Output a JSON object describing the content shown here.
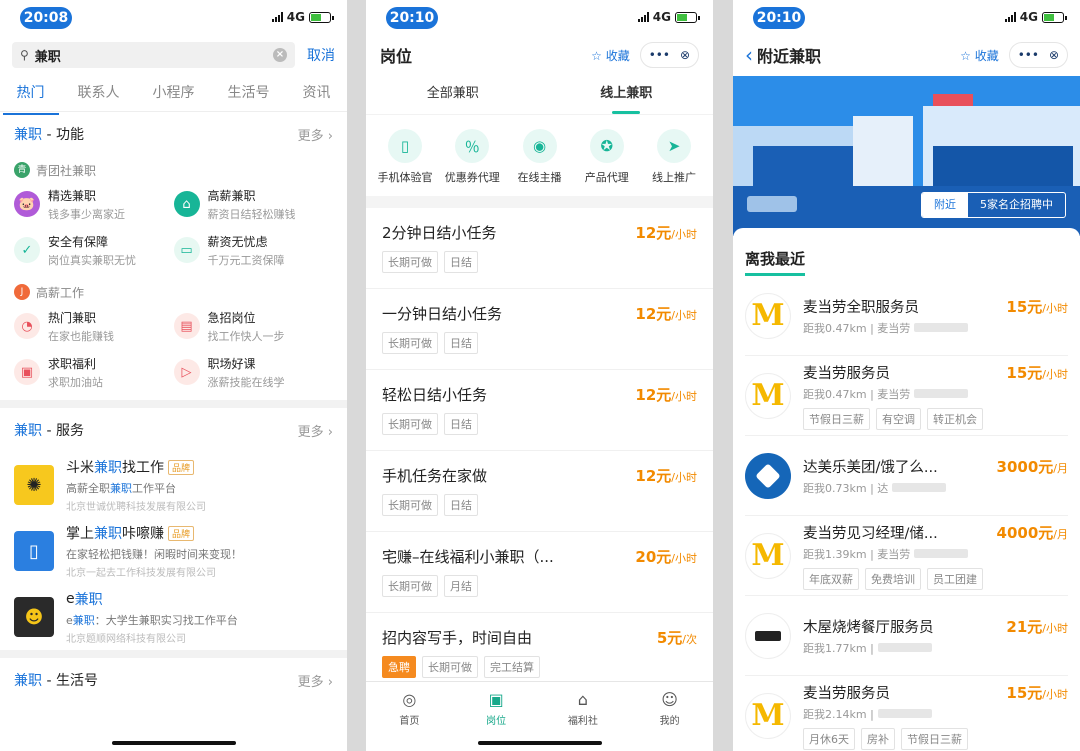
{
  "status": {
    "p1_time": "20:08",
    "p2_time": "20:10",
    "p3_time": "20:10",
    "network": "4G"
  },
  "p1": {
    "search_value": "兼职",
    "cancel": "取消",
    "tabs": [
      "热门",
      "联系人",
      "小程序",
      "生活号",
      "资讯"
    ],
    "func": {
      "kw": "兼职",
      "suffix": " - 功能",
      "more": "更多",
      "groups": [
        {
          "name": "青团社兼职",
          "badge": "青",
          "color": "#3aa36a",
          "items": [
            {
              "title": "精选兼职",
              "desc": "钱多事少离家近",
              "icon": "piggy-icon",
              "glyph": "🐷",
              "bg": "#b05bd8"
            },
            {
              "title": "高薪兼职",
              "desc": "薪资日结轻松赚钱",
              "icon": "house-icon",
              "glyph": "⌂",
              "bg": "#17b597"
            },
            {
              "title": "安全有保障",
              "desc": "岗位真实兼职无忧",
              "icon": "shield-icon",
              "glyph": "✓",
              "bg": "#e7f8f2"
            },
            {
              "title": "薪资无忧虑",
              "desc": "千万元工资保障",
              "icon": "wallet-icon",
              "glyph": "▭",
              "bg": "#e7f8f2"
            }
          ]
        },
        {
          "name": "高薪工作",
          "badge": "J",
          "color": "#f06a3a",
          "items": [
            {
              "title": "热门兼职",
              "desc": "在家也能赚钱",
              "icon": "clock-icon",
              "glyph": "◔",
              "bg": "#fde9e6"
            },
            {
              "title": "急招岗位",
              "desc": "找工作快人一步",
              "icon": "id-card-icon",
              "glyph": "▤",
              "bg": "#fde9e6"
            },
            {
              "title": "求职福利",
              "desc": "求职加油站",
              "icon": "gift-icon",
              "glyph": "▣",
              "bg": "#fde9e6"
            },
            {
              "title": "职场好课",
              "desc": "涨薪技能在线学",
              "icon": "play-icon",
              "glyph": "▷",
              "bg": "#fde9e6"
            }
          ]
        }
      ]
    },
    "service": {
      "kw": "兼职",
      "suffix": " - 服务",
      "more": "更多",
      "items": [
        {
          "pre": "斗米",
          "kw": "兼职",
          "post": "找工作",
          "badge": "品牌",
          "d_pre": "高薪全职",
          "d_kw": "兼职",
          "d_post": "工作平台",
          "company": "北京世诚优聘科技发展有限公司",
          "logo_bg": "#f7c81e",
          "glyph": "✺",
          "icon": "doumi-logo-icon"
        },
        {
          "pre": "掌上",
          "kw": "兼职",
          "post": "咔嚓赚",
          "badge": "品牌",
          "d_pre": "在家轻松把钱赚！闲暇时间来变现！",
          "d_kw": "",
          "d_post": "",
          "company": "北京一起去工作科技发展有限公司",
          "logo_bg": "#2b7fe0",
          "glyph": "▯",
          "icon": "phone-logo-icon"
        },
        {
          "pre": "e",
          "kw": "兼职",
          "post": "",
          "badge": "",
          "d_pre": "e",
          "d_kw": "兼职",
          "d_post": "：大学生兼职实习找工作平台",
          "company": "北京题顺网络科技有限公司",
          "logo_bg": "#2a2a2a",
          "glyph": "☻",
          "icon": "e-jianzhi-logo-icon"
        }
      ]
    },
    "life": {
      "kw": "兼职",
      "suffix": " - 生活号",
      "more": "更多"
    }
  },
  "p2": {
    "title": "岗位",
    "fav": "收藏",
    "more_dots": "•••",
    "tabs": [
      "全部兼职",
      "线上兼职"
    ],
    "cats": [
      {
        "label": "手机体验官",
        "icon": "phone-icon",
        "glyph": "▯"
      },
      {
        "label": "优惠券代理",
        "icon": "coupon-icon",
        "glyph": "％"
      },
      {
        "label": "在线主播",
        "icon": "streamer-icon",
        "glyph": "◉"
      },
      {
        "label": "产品代理",
        "icon": "medal-icon",
        "glyph": "✪"
      },
      {
        "label": "线上推广",
        "icon": "paper-plane-icon",
        "glyph": "➤"
      }
    ],
    "jobs": [
      {
        "title": "2分钟日结小任务",
        "price": "12元",
        "unit": "/小时",
        "tags": [
          {
            "t": "长期可做",
            "hot": false
          },
          {
            "t": "日结",
            "hot": false
          }
        ]
      },
      {
        "title": "一分钟日结小任务",
        "price": "12元",
        "unit": "/小时",
        "tags": [
          {
            "t": "长期可做",
            "hot": false
          },
          {
            "t": "日结",
            "hot": false
          }
        ]
      },
      {
        "title": "轻松日结小任务",
        "price": "12元",
        "unit": "/小时",
        "tags": [
          {
            "t": "长期可做",
            "hot": false
          },
          {
            "t": "日结",
            "hot": false
          }
        ]
      },
      {
        "title": "手机任务在家做",
        "price": "12元",
        "unit": "/小时",
        "tags": [
          {
            "t": "长期可做",
            "hot": false
          },
          {
            "t": "日结",
            "hot": false
          }
        ]
      },
      {
        "title": "宅赚–在线福利小兼职（...",
        "price": "20元",
        "unit": "/小时",
        "tags": [
          {
            "t": "长期可做",
            "hot": false
          },
          {
            "t": "月结",
            "hot": false
          }
        ]
      },
      {
        "title": "招内容写手，时间自由",
        "price": "5元",
        "unit": "/次",
        "tags": [
          {
            "t": "急聘",
            "hot": true
          },
          {
            "t": "长期可做",
            "hot": false
          },
          {
            "t": "完工结算",
            "hot": false
          }
        ]
      }
    ],
    "tabbar": [
      {
        "label": "首页",
        "icon": "compass-icon",
        "glyph": "◎",
        "active": false
      },
      {
        "label": "岗位",
        "icon": "briefcase-icon",
        "glyph": "▣",
        "active": true
      },
      {
        "label": "福利社",
        "icon": "store-icon",
        "glyph": "⌂",
        "active": false
      },
      {
        "label": "我的",
        "icon": "smile-icon",
        "glyph": "☺",
        "active": false
      }
    ]
  },
  "p3": {
    "title": "附近兼职",
    "fav": "收藏",
    "more_dots": "•••",
    "banner_near": "附近",
    "banner_count": "5家名企招聘中",
    "section": "离我最近",
    "jobs": [
      {
        "title": "麦当劳全职服务员",
        "price": "15元",
        "unit": "/小时",
        "dist": "距我0.47km | 麦当劳",
        "logo": "mcd",
        "tags": []
      },
      {
        "title": "麦当劳服务员",
        "price": "15元",
        "unit": "/小时",
        "dist": "距我0.47km | 麦当劳",
        "logo": "mcd",
        "tags": [
          "节假日三薪",
          "有空调",
          "转正机会"
        ]
      },
      {
        "title": "达美乐美团/饿了么...",
        "price": "3000元",
        "unit": "/月",
        "dist": "距我0.73km | 达",
        "logo": "dominos",
        "tags": []
      },
      {
        "title": "麦当劳见习经理/储...",
        "price": "4000元",
        "unit": "/月",
        "dist": "距我1.39km | 麦当劳",
        "logo": "mcd",
        "tags": [
          "年底双薪",
          "免费培训",
          "员工团建"
        ]
      },
      {
        "title": "木屋烧烤餐厅服务员",
        "price": "21元",
        "unit": "/小时",
        "dist": "距我1.77km |",
        "logo": "muwu",
        "tags": []
      },
      {
        "title": "麦当劳服务员",
        "price": "15元",
        "unit": "/小时",
        "dist": "距我2.14km |",
        "logo": "mcd",
        "tags": [
          "月休6天",
          "房补",
          "节假日三薪"
        ]
      }
    ]
  }
}
